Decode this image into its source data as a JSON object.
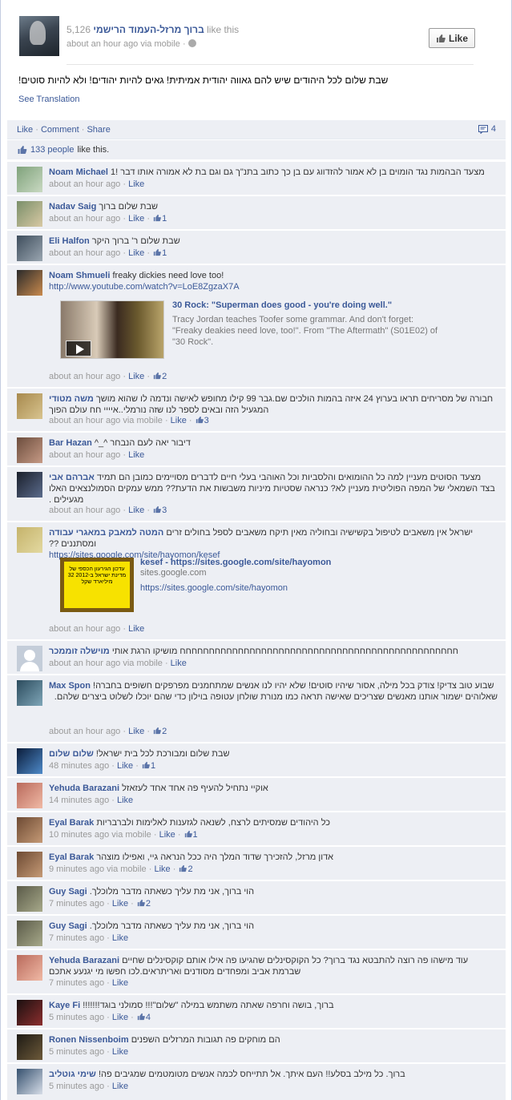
{
  "header": {
    "like_count": "5,126",
    "page_name": "ברוך מרזל-העמוד הרישמי",
    "like_this": "like this",
    "time": "about an hour ago via mobile",
    "like_button": "Like",
    "status": "שבת שלום לכל היהודים שיש להם גאווה יהודית אמיתית! גאים להיות יהודים! ולא להיות סוטים!",
    "see_translation": "See Translation"
  },
  "actions": {
    "like": "Like",
    "comment": "Comment",
    "share": "Share",
    "comment_count": "4"
  },
  "likes": {
    "count": "133 people",
    "suffix": "like this."
  },
  "comments": [
    {
      "name": "Noam Michael",
      "text": "מצעד הבהמות נגד הומוים בן לא אמור להזדווג עם בן כך כתוב בתנ\"ך גם וגם בת לא אמורה אותו דבר !1",
      "time": "about an hour ago",
      "like": "Like",
      "likes": ""
    },
    {
      "name": "Nadav Saig",
      "text": "שבת שלום ברוך",
      "time": "about an hour ago",
      "like": "Like",
      "likes": "1"
    },
    {
      "name": "Eli Halfon",
      "text": "שבת שלום ר' ברוך היקר",
      "time": "about an hour ago",
      "like": "Like",
      "likes": "1"
    },
    {
      "name": "Noam Shmueli",
      "text": "freaky dickies need love too!",
      "link": "http://www.youtube.com/watch?v=LoE8ZgzaX7A",
      "preview_title": "30 Rock: \"Superman does good - you're doing well.\"",
      "preview_desc": "Tracy Jordan teaches Toofer some grammar. And don't forget: \"Freaky deakies need love, too!\". From \"The Aftermath\" (S01E02) of \"30 Rock\".",
      "time": "about an hour ago",
      "like": "Like",
      "likes": "2"
    },
    {
      "name": "משה מטודי",
      "text": "חבורה של מסריחים תראו בערוץ 24 איזה בהמות הולכים שם.גבר 99 קילו מחופש לאישה ונדמה לו שהוא מושך המגעיל הזה ובאים לספר לנו שזה נורמלי..איייי חח עולם הפוך",
      "time": "about an hour ago via mobile",
      "like": "Like",
      "likes": "3"
    },
    {
      "name": "Bar Hazan",
      "text": "דיבור יאה לעם הנבחר ^_^",
      "time": "about an hour ago",
      "like": "Like",
      "likes": ""
    },
    {
      "name": "אברהם אבי",
      "text": "מצעד הסוטים מעניין למה כל ההומואים והלסביות וכל האוהבי בעלי חיים לדברים מסויימים כמובן הם תמיד בצד השמאלי של המפה הפוליטית מעניין לא? כנראה שסטיות מיניות משבשות את הדעת?? ממש עמקים הסמולנצאים האלו מגעילים .",
      "time": "about an hour ago",
      "like": "Like",
      "likes": "3"
    },
    {
      "name": "המטה למאבק במאגרי עבודה",
      "text": "ישראל אין משאבים לטיפול בקשישיה ובחוליה מאין תיקח משאבים לספל בחולים זרים ומסתננים ??",
      "link": "https://sites.google.com/site/hayomon/kesef",
      "preview_title": "kesef - https://sites.google.com/site/hayomon",
      "preview_site": "sites.google.com",
      "preview_link": "https://sites.google.com/site/hayomon",
      "preview_img_text": "עדכון הגירעון הכספי של מדינת ישראל ב-2012 32 מיליארד שקל",
      "time": "about an hour ago",
      "like": "Like",
      "likes": ""
    },
    {
      "name": "מוישלה זוממכר",
      "text": "חחחחחחחחחחחחחחחחחחחחחחחחחחחחחחחחחחחחחחחחחחחחחחחח מושיקו הרגת אותי",
      "time": "about an hour ago via mobile",
      "like": "Like",
      "likes": ""
    },
    {
      "name": "Max Spon",
      "text": "שבוע טוב צדיק! צודק בכל מילה, אסור שיהיו סוטים! שלא יהיו לנו אנשים שמתחמנים מפרפקים חשופים בחברה!",
      "text2": "שאלוהים ישמור אותנו מאנשים שצריכים שאישה תראה כמו מנורת שולחן עטופה בוילון כדי שהם יוכלו לשלוט ביצרים שלהם.",
      "time": "about an hour ago",
      "like": "Like",
      "likes": "2"
    },
    {
      "name": "שלום שלום",
      "text": "שבת שלום ומבורכת לכל בית ישראל!",
      "time": "48 minutes ago",
      "like": "Like",
      "likes": "1"
    },
    {
      "name": "Yehuda Barazani",
      "text": "אוקיי נתחיל להעיף פה אחד אחד לעזאזל",
      "time": "14 minutes ago",
      "like": "Like",
      "likes": ""
    },
    {
      "name": "Eyal Barak",
      "text": "כל היהודים שמסיתים לרצח, לשנאה לגזענות לאלימות ולברבריות",
      "time": "10 minutes ago via mobile",
      "like": "Like",
      "likes": "1"
    },
    {
      "name": "Eyal Barak",
      "text": "אדון מרזל, להזכירך שדוד המלך היה ככל הנראה גיי, ואפילו מוצהר",
      "time": "9 minutes ago via mobile",
      "like": "Like",
      "likes": "2"
    },
    {
      "name": "Guy Sagi",
      "text": "הוי ברוך, אני מת עליך כשאתה מדבר מלוכלך.",
      "time": "7 minutes ago",
      "like": "Like",
      "likes": "2"
    },
    {
      "name": "Guy Sagi",
      "text": "הוי ברוך, אני מת עליך כשאתה מדבר מלוכלך.",
      "time": "7 minutes ago",
      "like": "Like",
      "likes": ""
    },
    {
      "name": "Yehuda Barazani",
      "text": "עוד מישהו פה רוצה להתבטא נגד ברוך? כל הקוקסינלים שהגיעו פה אילו אותם קוקסינלים שחיים שברמת אביב ומפחדים מסודנים ואריתראים.לכו חפשו מי יגנעע אתכם",
      "time": "7 minutes ago",
      "like": "Like",
      "likes": ""
    },
    {
      "name": "Kaye Fi",
      "text": "ברוך, בושה וחרפה שאתה משתמש במילה \"שלום\"!!! סמולני בוגד!!!!!!!",
      "time": "5 minutes ago",
      "like": "Like",
      "likes": "4"
    },
    {
      "name": "Ronen Nissenboim",
      "text": "הם מוחקים פה תגובות המרזלים השפנים",
      "time": "5 minutes ago",
      "like": "Like",
      "likes": ""
    },
    {
      "name": "שימי גוטליב",
      "text": "ברוך. כל מילב בסלע!! העם איתך. אל תתייחס לכמה אנשים מטומטמים שמגיבים פה!",
      "time": "5 minutes ago",
      "like": "Like",
      "likes": ""
    }
  ]
}
